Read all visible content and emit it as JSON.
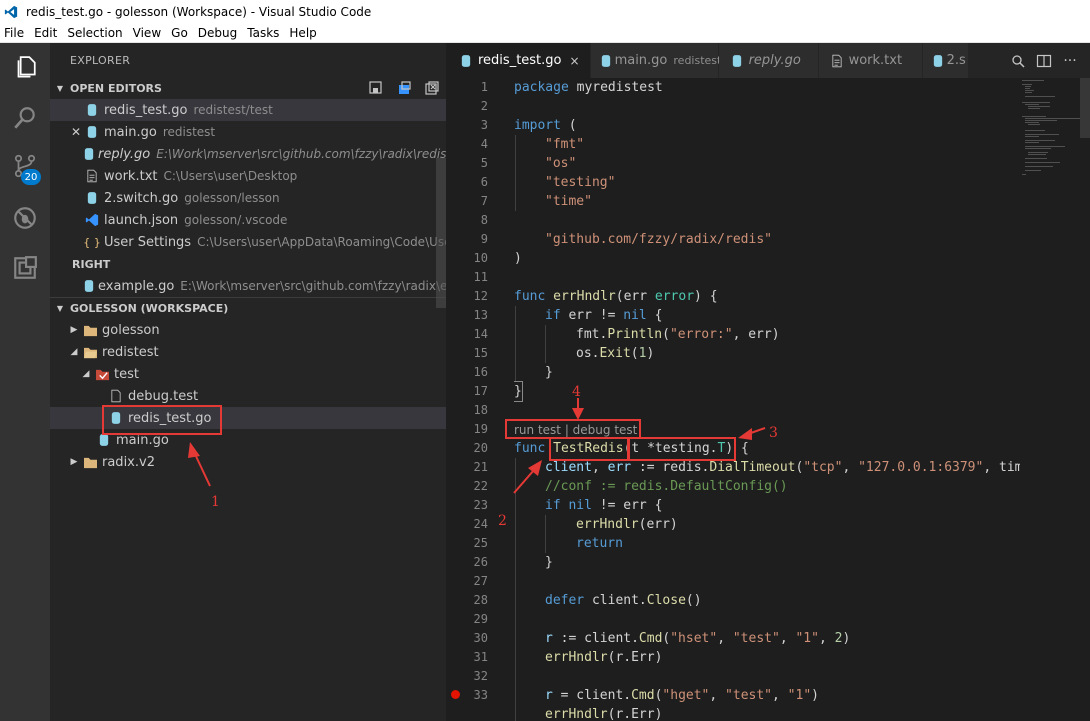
{
  "window": {
    "title": "redis_test.go - golesson (Workspace) - Visual Studio Code"
  },
  "menu": [
    "File",
    "Edit",
    "Selection",
    "View",
    "Go",
    "Debug",
    "Tasks",
    "Help"
  ],
  "activity_bar": {
    "items": [
      "files-icon",
      "search-icon",
      "source-control-icon",
      "debug-icon",
      "extensions-icon"
    ],
    "scm_badge": "20"
  },
  "sidebar": {
    "header": "EXPLORER",
    "open_editors": {
      "title": "OPEN EDITORS",
      "items": [
        {
          "name": "redis_test.go",
          "desc": "redistest/test"
        },
        {
          "name": "main.go",
          "desc": "redistest"
        },
        {
          "name": "reply.go",
          "desc": "E:\\Work\\mserver\\src\\github.com\\fzzy\\radix\\redis"
        },
        {
          "name": "work.txt",
          "desc": "C:\\Users\\user\\Desktop"
        },
        {
          "name": "2.switch.go",
          "desc": "golesson/lesson"
        },
        {
          "name": "launch.json",
          "desc": "golesson/.vscode"
        },
        {
          "name": "User Settings",
          "desc": "C:\\Users\\user\\AppData\\Roaming\\Code\\User"
        }
      ],
      "right_group": "RIGHT",
      "right_items": [
        {
          "name": "example.go",
          "desc": "E:\\Work\\mserver\\src\\github.com\\fzzy\\radix\\examp..."
        }
      ]
    },
    "workspace": {
      "title": "GOLESSON (WORKSPACE)",
      "items": [
        {
          "name": "golesson"
        },
        {
          "name": "redistest"
        },
        {
          "name": "test"
        },
        {
          "name": "debug.test"
        },
        {
          "name": "redis_test.go"
        },
        {
          "name": "main.go"
        },
        {
          "name": "radix.v2"
        }
      ]
    }
  },
  "tabs": [
    {
      "name": "redis_test.go",
      "desc": "",
      "close": "×"
    },
    {
      "name": "main.go",
      "desc": "redistest"
    },
    {
      "name": "reply.go",
      "desc": ""
    },
    {
      "name": "work.txt",
      "desc": ""
    },
    {
      "name": "2.s",
      "desc": ""
    }
  ],
  "editor": {
    "line_numbers": [
      "1",
      "2",
      "3",
      "4",
      "5",
      "6",
      "7",
      "8",
      "9",
      "10",
      "11",
      "12",
      "13",
      "14",
      "15",
      "16",
      "17",
      "18",
      "19",
      "20",
      "21",
      "22",
      "23",
      "24",
      "25",
      "26",
      "27",
      "28",
      "29",
      "30",
      "31",
      "32",
      "33"
    ],
    "codelens": "run test | debug test",
    "breakpoint_line": "32",
    "code": {
      "l1": [
        "package",
        " myredistest"
      ],
      "l3": [
        "import",
        " ("
      ],
      "l4": "\"fmt\"",
      "l5": "\"os\"",
      "l6": "\"testing\"",
      "l7": "\"time\"",
      "l9": "\"github.com/fzzy/radix/redis\"",
      "l10": ")",
      "l12": [
        "func",
        " ",
        "errHndlr",
        "(err ",
        "error",
        ") {"
      ],
      "l13": [
        "if",
        " err != ",
        "nil",
        " {"
      ],
      "l14": [
        "fmt.",
        "Println",
        "(",
        "\"error:\"",
        ", err)"
      ],
      "l15": [
        "os.",
        "Exit",
        "(",
        "1",
        ")"
      ],
      "l16": "}",
      "l17": "}",
      "l19": [
        "func",
        " ",
        "TestRedis",
        "(t *testing.",
        "T",
        ") {"
      ],
      "l20": [
        "client",
        ", ",
        "err",
        " := redis.",
        "DialTimeout",
        "(",
        "\"tcp\"",
        ", ",
        "\"127.0.0.1:6379\"",
        ", time"
      ],
      "l21": "//conf := redis.DefaultConfig()",
      "l22": [
        "if",
        " ",
        "nil",
        " != err {"
      ],
      "l23": [
        "errHndlr",
        "(err)"
      ],
      "l24": "return",
      "l25": "}",
      "l27": [
        "defer",
        " client.",
        "Close",
        "()"
      ],
      "l29": [
        "r",
        " := client.",
        "Cmd",
        "(",
        "\"hset\"",
        ", ",
        "\"test\"",
        ", ",
        "\"1\"",
        ", ",
        "2",
        ")"
      ],
      "l30": [
        "errHndlr",
        "(r.Err)"
      ],
      "l32": [
        "r",
        " = client.",
        "Cmd",
        "(",
        "\"hget\"",
        ", ",
        "\"test\"",
        ", ",
        "\"1\"",
        ")"
      ],
      "l33": [
        "errHndlr",
        "(r.Err)"
      ]
    }
  },
  "annotations": [
    "1",
    "2",
    "3",
    "4"
  ],
  "colors": {
    "accent": "#007acc",
    "annotation": "#e53935",
    "keyword": "#569cd6",
    "string": "#ce9178",
    "function": "#dcdcaa"
  }
}
